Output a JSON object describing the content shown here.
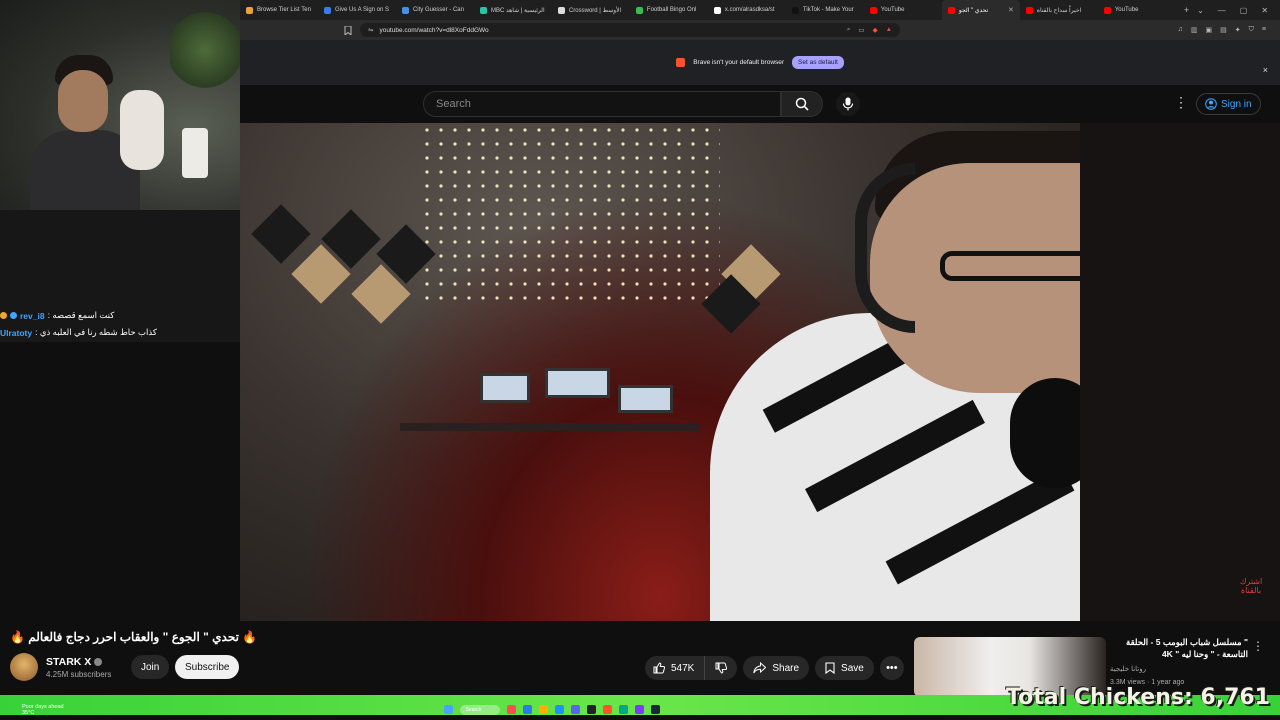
{
  "browser": {
    "tabs": [
      {
        "label": "Browse Tier List Ten",
        "color": "#e8a33d",
        "active": false
      },
      {
        "label": "Give Us A Sign on S",
        "color": "#3d7be8",
        "active": false
      },
      {
        "label": "City Guesser - Can",
        "color": "#4a90e2",
        "active": false
      },
      {
        "label": "MBC الرئيسية | شاهد",
        "color": "#27c4a8",
        "active": false
      },
      {
        "label": "Crossword | الأوسط",
        "color": "#dddddd",
        "active": false
      },
      {
        "label": "Football Bingo Onl",
        "color": "#3cba54",
        "active": false
      },
      {
        "label": "x.com/alrasdksa/st",
        "color": "#ffffff",
        "active": false
      },
      {
        "label": "TikTok - Make Your",
        "color": "#111111",
        "active": false
      },
      {
        "label": "YouTube",
        "color": "#ff0000",
        "active": false
      },
      {
        "label": "تحدي \" الجو",
        "color": "#ff0000",
        "active": true
      },
      {
        "label": "اخيراً سداح بالقناة",
        "color": "#ff0000",
        "active": false
      },
      {
        "label": "YouTube",
        "color": "#ff0000",
        "active": false
      }
    ],
    "new_tab": "+",
    "url": "youtube.com/watch?v=dl8XoFddGWo"
  },
  "banner": {
    "text": "Brave isn't your default browser",
    "button": "Set as default",
    "close": "×"
  },
  "youtube": {
    "search_placeholder": "Search",
    "sign_in": "Sign in",
    "menu": "⋮"
  },
  "video": {
    "watermark": "اشترك بالقناة"
  },
  "chat": [
    {
      "user": "rev_i8",
      "message": "كنت اسمع قصصه :",
      "user_color": "#3ea6ff",
      "badge_colors": [
        "#3ea6ff",
        "#f5a623"
      ]
    },
    {
      "user": "Ulratoty",
      "message": "كذاب حاط شطه رنا في العلبه ذي :",
      "user_color": "#3ea6ff",
      "badge_colors": []
    }
  ],
  "watch": {
    "title": "🔥 تحدي \" الجوع \" والعقاب احرر دجاج فالعالم 🔥",
    "channel_name": "STARK X",
    "subscribers": "4.25M subscribers",
    "join": "Join",
    "subscribe": "Subscribe",
    "likes": "547K",
    "share": "Share",
    "save": "Save"
  },
  "recommended": {
    "title": "\" مسلسل شباب البومب 5 - الحلقة التاسعة - \" وحنا ليه \" 4K",
    "channel": "روتانا خليجية",
    "meta": "3.3M views · 1 year ago"
  },
  "overlay": {
    "chickens_counter": "Total Chickens: 6,761"
  },
  "taskbar": {
    "weather_line1": "Poor days ahead",
    "weather_line2": "35°C",
    "search": "Search"
  },
  "colors": {
    "accent_blue": "#3ea6ff",
    "brave_orange": "#fb542b",
    "overlay_green": "#38d238"
  }
}
